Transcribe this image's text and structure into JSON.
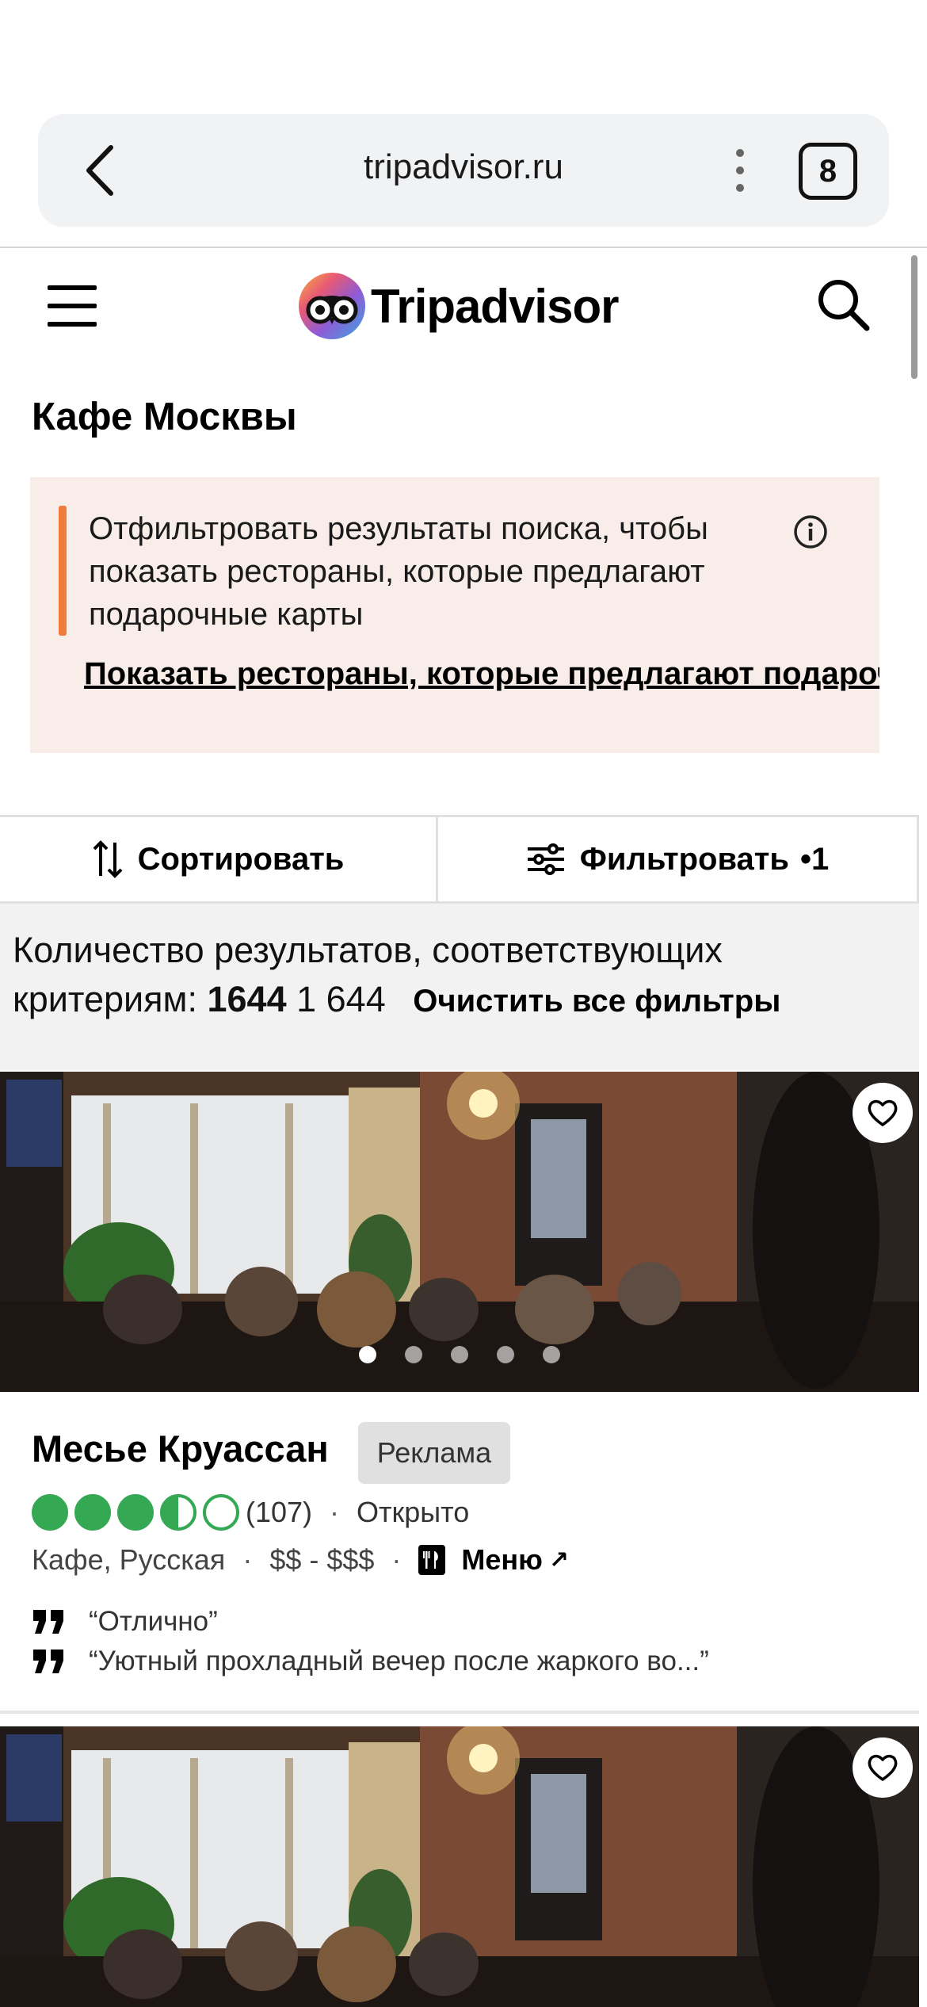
{
  "browser": {
    "url": "tripadvisor.ru",
    "tab_count": "8"
  },
  "header": {
    "logo_text": "Tripadvisor"
  },
  "page": {
    "title": "Кафе Москвы"
  },
  "banner": {
    "text": "Отфильтровать результаты поиска, чтобы показать рестораны, которые предлагают подарочные карты",
    "link": "Показать рестораны, которые предлагают подарочные карты",
    "accent_color": "#ef7c3b"
  },
  "controls": {
    "sort_label": "Сортировать",
    "filter_label": "Фильтровать",
    "filter_count": "•1"
  },
  "results": {
    "label_line1": "Количество результатов, соответствующих",
    "label_line2": "критериям:",
    "count_bold": "1644",
    "count_formatted": "1 644",
    "clear_label": "Очистить все фильтры"
  },
  "listing": {
    "name": "Месье Круассан",
    "ad_badge": "Реклама",
    "rating_bubbles": 3.5,
    "review_count": "(107)",
    "separator": "·",
    "status": "Открыто",
    "cuisine": "Кафе, Русская",
    "price": "$$ - $$$",
    "menu_label": "Меню",
    "menu_arrow": "↗",
    "quotes": [
      "“Отлично”",
      "“Уютный прохладный вечер после жаркого во...”"
    ],
    "photo_count": 5,
    "active_photo": 1,
    "rating_color": "#34a853"
  }
}
